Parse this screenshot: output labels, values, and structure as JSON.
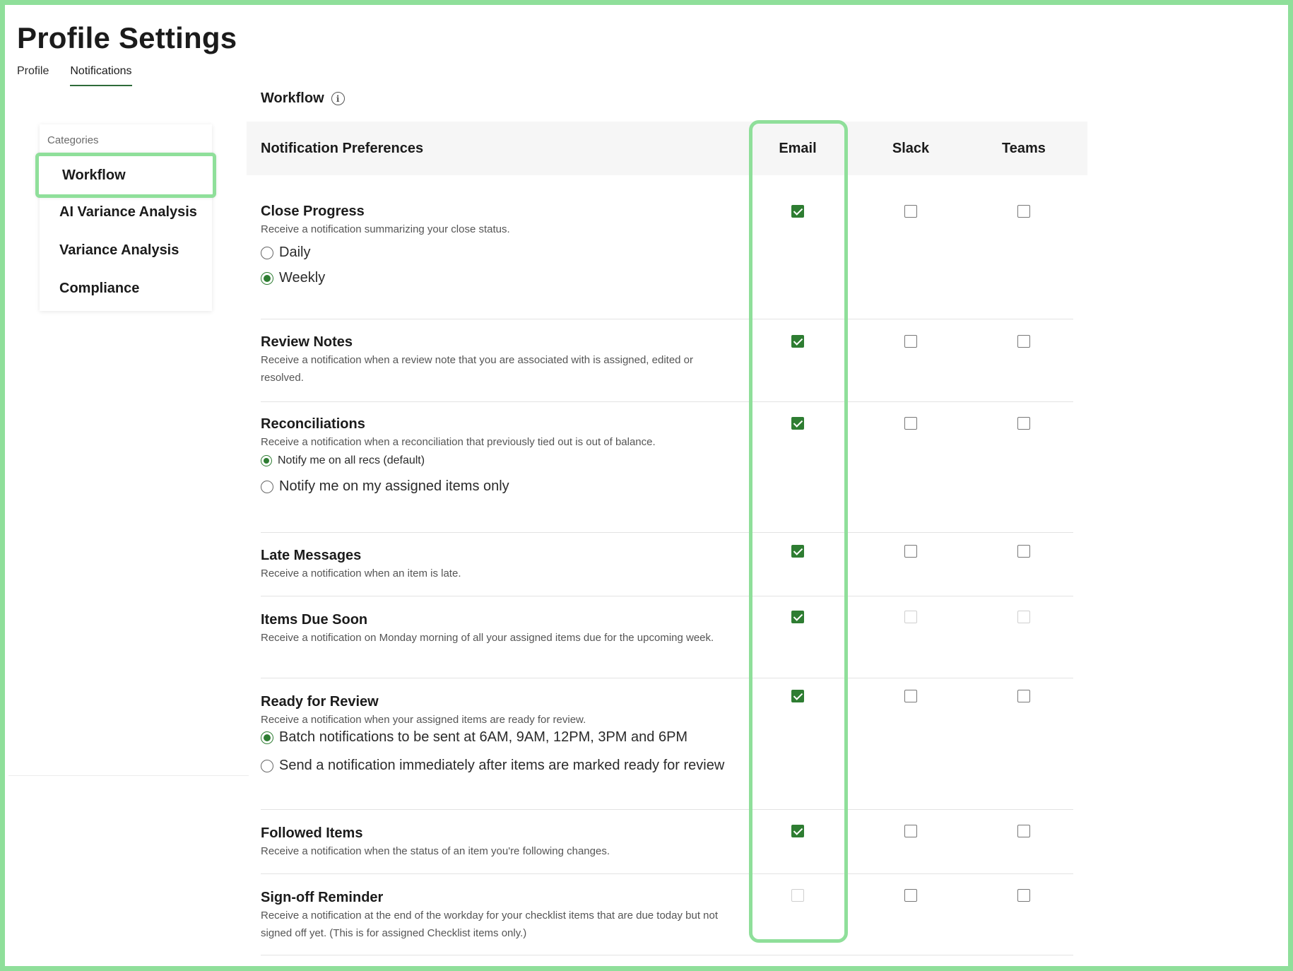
{
  "page": {
    "title": "Profile Settings"
  },
  "tabs": [
    {
      "label": "Profile",
      "active": false
    },
    {
      "label": "Notifications",
      "active": true
    }
  ],
  "sidebar": {
    "label": "Categories",
    "items": [
      {
        "label": "Workflow",
        "selected": true
      },
      {
        "label": "AI Variance Analysis",
        "selected": false
      },
      {
        "label": "Variance Analysis",
        "selected": false
      },
      {
        "label": "Compliance",
        "selected": false
      }
    ]
  },
  "section": {
    "title": "Workflow"
  },
  "table": {
    "header": {
      "prefs": "Notification Preferences",
      "email": "Email",
      "slack": "Slack",
      "teams": "Teams"
    },
    "rows": [
      {
        "title": "Close Progress",
        "desc": "Receive a notification summarizing your close status.",
        "options": [
          {
            "label": "Daily",
            "selected": false
          },
          {
            "label": "Weekly",
            "selected": true
          }
        ],
        "email": "checked",
        "slack": "unchecked",
        "teams": "unchecked"
      },
      {
        "title": "Review Notes",
        "desc": "Receive a notification when a review note that you are associated with is assigned, edited or resolved.",
        "email": "checked",
        "slack": "unchecked",
        "teams": "unchecked"
      },
      {
        "title": "Reconciliations",
        "desc": "Receive a notification when a reconciliation that previously tied out is out of balance.",
        "options": [
          {
            "label": "Notify me on all recs (default)",
            "selected": true
          },
          {
            "label": "Notify me on my assigned items only",
            "selected": false
          }
        ],
        "email": "checked",
        "slack": "unchecked",
        "teams": "unchecked"
      },
      {
        "title": "Late Messages",
        "desc": "Receive a notification when an item is late.",
        "email": "checked",
        "slack": "unchecked",
        "teams": "unchecked"
      },
      {
        "title": "Items Due Soon",
        "desc": "Receive a notification on Monday morning of all your assigned items due for the upcoming week.",
        "email": "checked",
        "slack": "disabled",
        "teams": "disabled"
      },
      {
        "title": "Ready for Review",
        "desc": "Receive a notification when your assigned items are ready for review.",
        "options": [
          {
            "label": "Batch notifications to be sent at 6AM, 9AM, 12PM, 3PM and 6PM",
            "selected": true
          },
          {
            "label": "Send a notification immediately after items are marked ready for review",
            "selected": false
          }
        ],
        "email": "checked",
        "slack": "unchecked",
        "teams": "unchecked"
      },
      {
        "title": "Followed Items",
        "desc": "Receive a notification when the status of an item you're following changes.",
        "email": "checked",
        "slack": "unchecked",
        "teams": "unchecked"
      },
      {
        "title": "Sign-off Reminder",
        "desc": "Receive a notification at the end of the workday for your checklist items that are due today but not signed off yet. (This is for assigned Checklist items only.)",
        "email": "disabled",
        "slack": "unchecked",
        "teams": "unchecked"
      }
    ]
  }
}
